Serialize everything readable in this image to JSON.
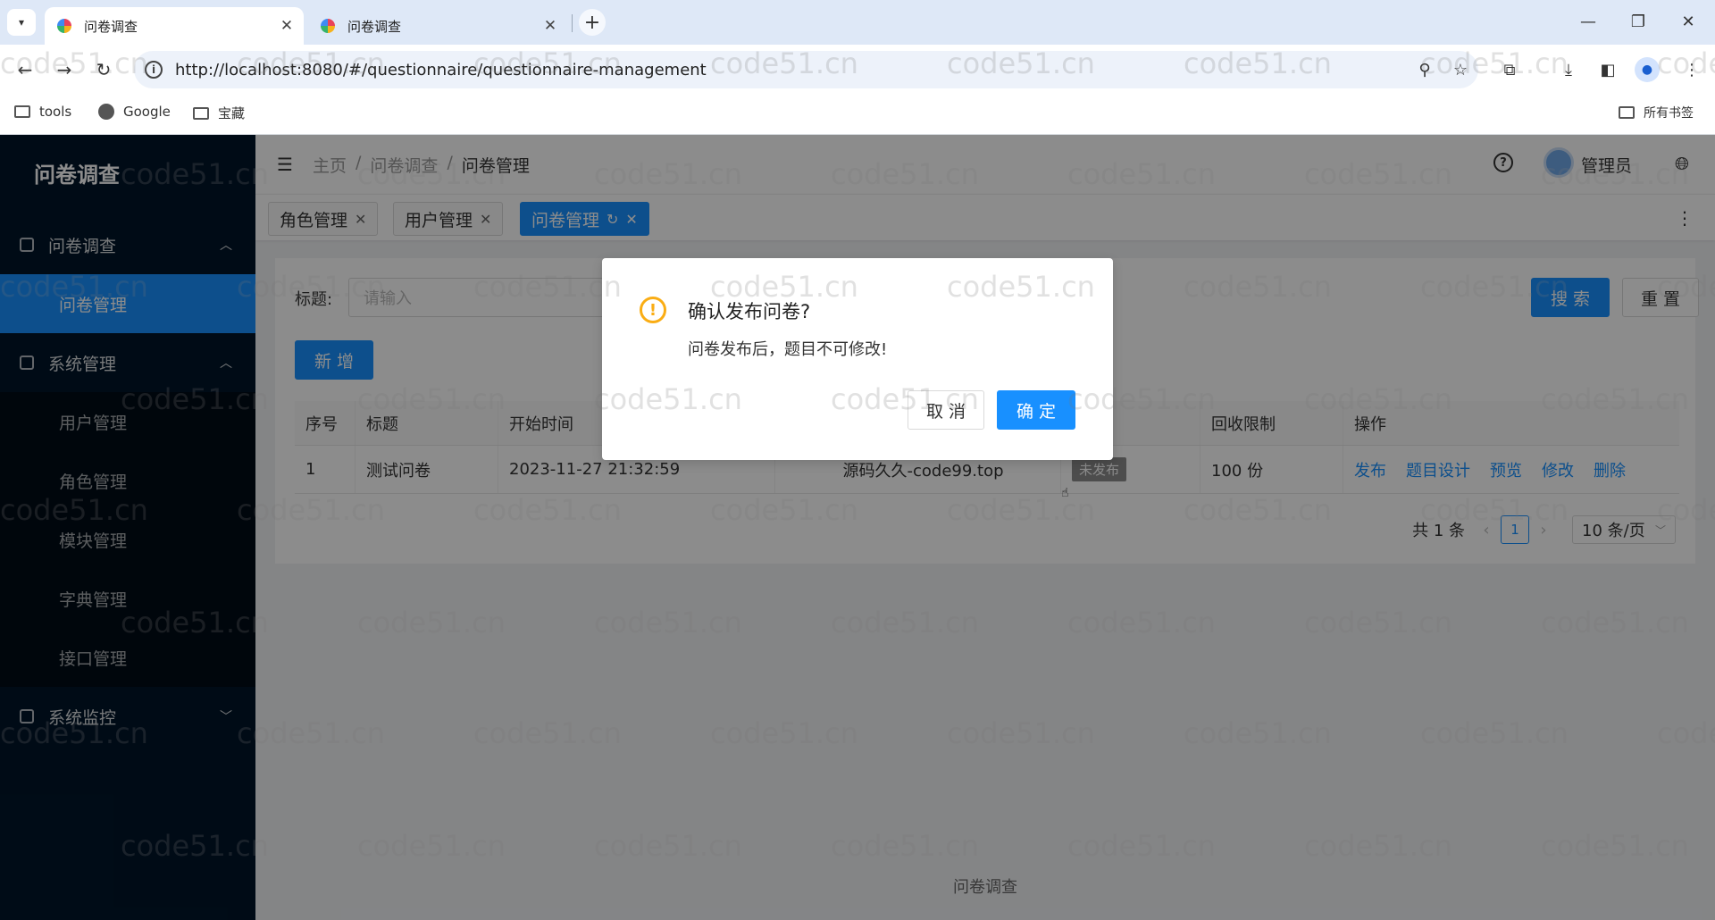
{
  "browser": {
    "tabs": [
      {
        "title": "问卷调查",
        "active": true
      },
      {
        "title": "问卷调查",
        "active": false
      }
    ],
    "url": "http://localhost:8080/#/questionnaire/questionnaire-management",
    "bookmarks": [
      "tools",
      "Google",
      "宝藏"
    ],
    "all_bookmarks": "所有书签"
  },
  "sidebar": {
    "logo": "问卷调查",
    "groups": [
      {
        "label": "问卷调查",
        "expanded": true,
        "items": [
          "问卷管理"
        ]
      },
      {
        "label": "系统管理",
        "expanded": true,
        "items": [
          "用户管理",
          "角色管理",
          "模块管理",
          "字典管理",
          "接口管理"
        ]
      },
      {
        "label": "系统监控",
        "expanded": false,
        "items": []
      }
    ],
    "selected": "问卷管理"
  },
  "header": {
    "breadcrumb": [
      "主页",
      "问卷调查",
      "问卷管理"
    ],
    "username": "管理员"
  },
  "tags": [
    "角色管理",
    "用户管理",
    "问卷管理"
  ],
  "search": {
    "label": "标题:",
    "placeholder": "请输入",
    "search_btn": "搜 索",
    "reset_btn": "重 置",
    "add_btn": "新 增"
  },
  "table": {
    "columns": [
      "序号",
      "标题",
      "开始时间",
      "",
      "",
      "回收限制",
      "操作"
    ],
    "rows": [
      {
        "index": "1",
        "title": "测试问卷",
        "start": "2023-11-27 21:32:59",
        "end_partial": "源码久久-code99.top",
        "status": "未发布",
        "limit": "100 份"
      }
    ],
    "actions": [
      "发布",
      "题目设计",
      "预览",
      "修改",
      "删除"
    ]
  },
  "pagination": {
    "total": "共 1 条",
    "page": "1",
    "size": "10 条/页"
  },
  "footer": "问卷调查",
  "modal": {
    "title": "确认发布问卷?",
    "content": "问卷发布后，题目不可修改!",
    "cancel": "取 消",
    "ok": "确 定"
  },
  "watermark": "code51.cn",
  "colors": {
    "primary": "#1890ff",
    "sidebar": "#001529",
    "warning": "#faad14"
  }
}
